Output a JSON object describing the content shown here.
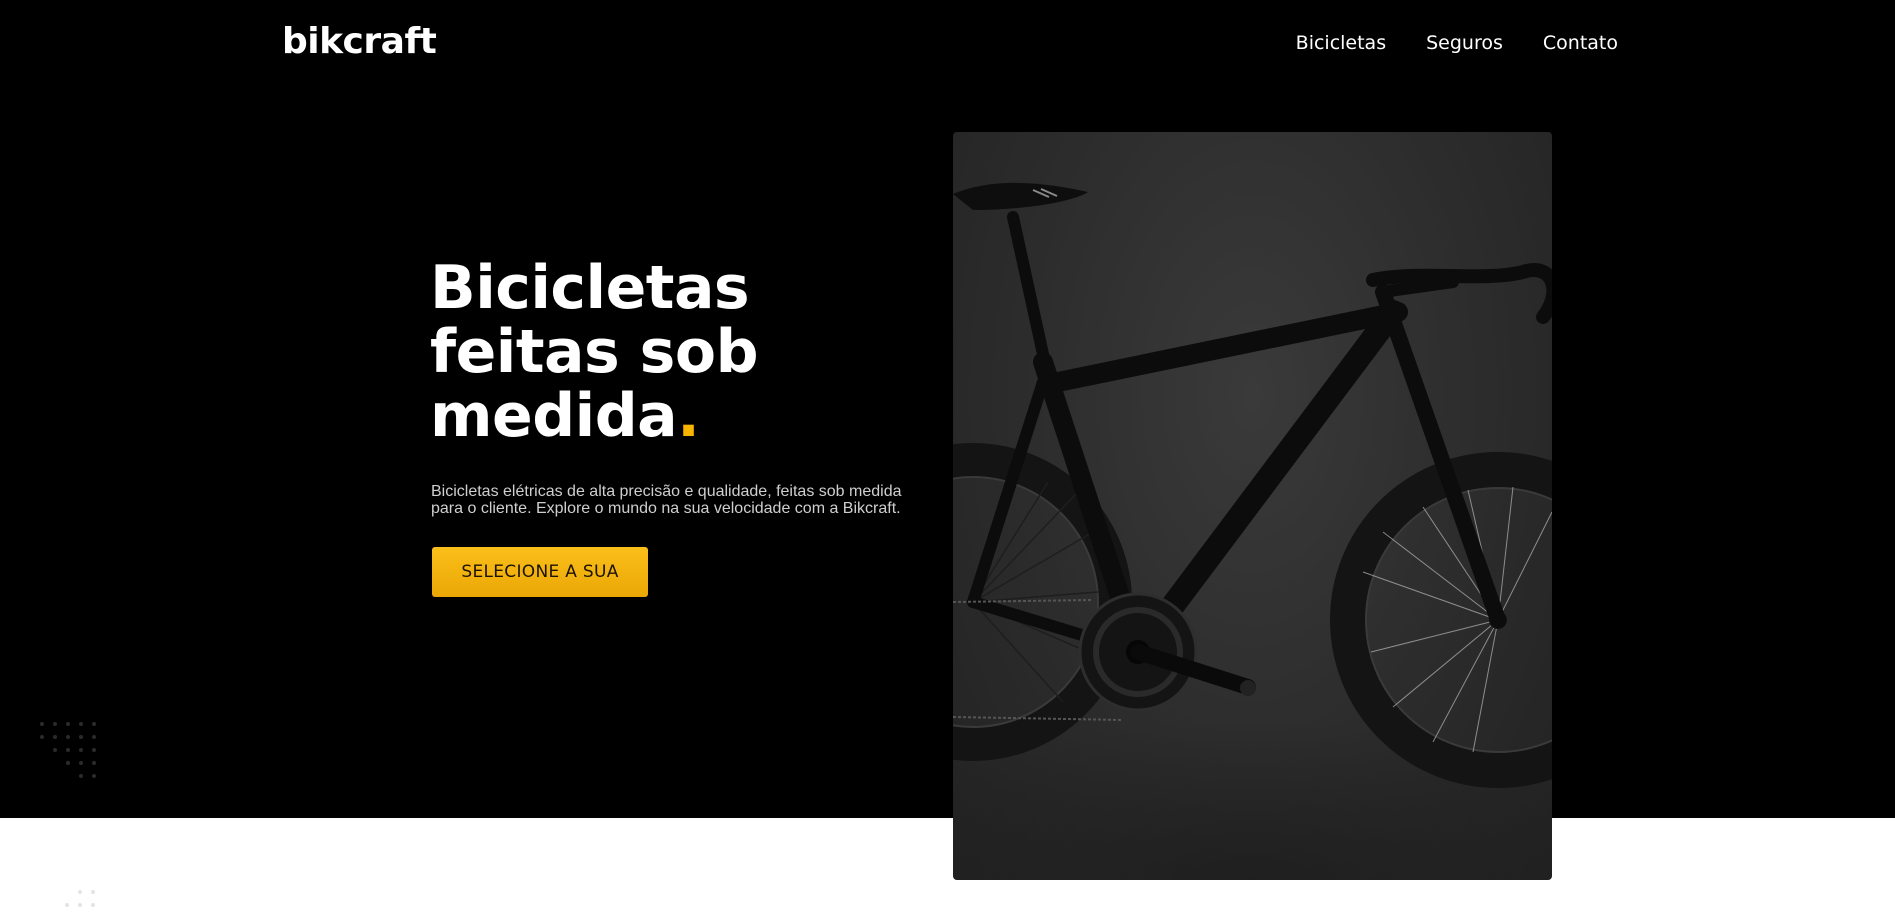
{
  "brand": {
    "logo": "bikcraft",
    "accent_color": "#f7b500",
    "hero_bg_color": "#000000"
  },
  "nav": {
    "items": [
      {
        "label": "Bicicletas"
      },
      {
        "label": "Seguros"
      },
      {
        "label": "Contato"
      }
    ]
  },
  "hero": {
    "title_lines": [
      "Bicicletas",
      "feitas sob",
      "medida"
    ],
    "title_dot": ".",
    "description_line1": "Bicicletas elétricas de alta precisão e qualidade, feitas sob medida",
    "description_line2": "para o cliente. Explore o mundo na sua velocidade com a Bikcraft.",
    "cta_label": "SELECIONE A SUA",
    "image_icon": "road-bicycle-photo"
  },
  "decorations": {
    "dot_grid_icon": "dot-grid-icon"
  }
}
